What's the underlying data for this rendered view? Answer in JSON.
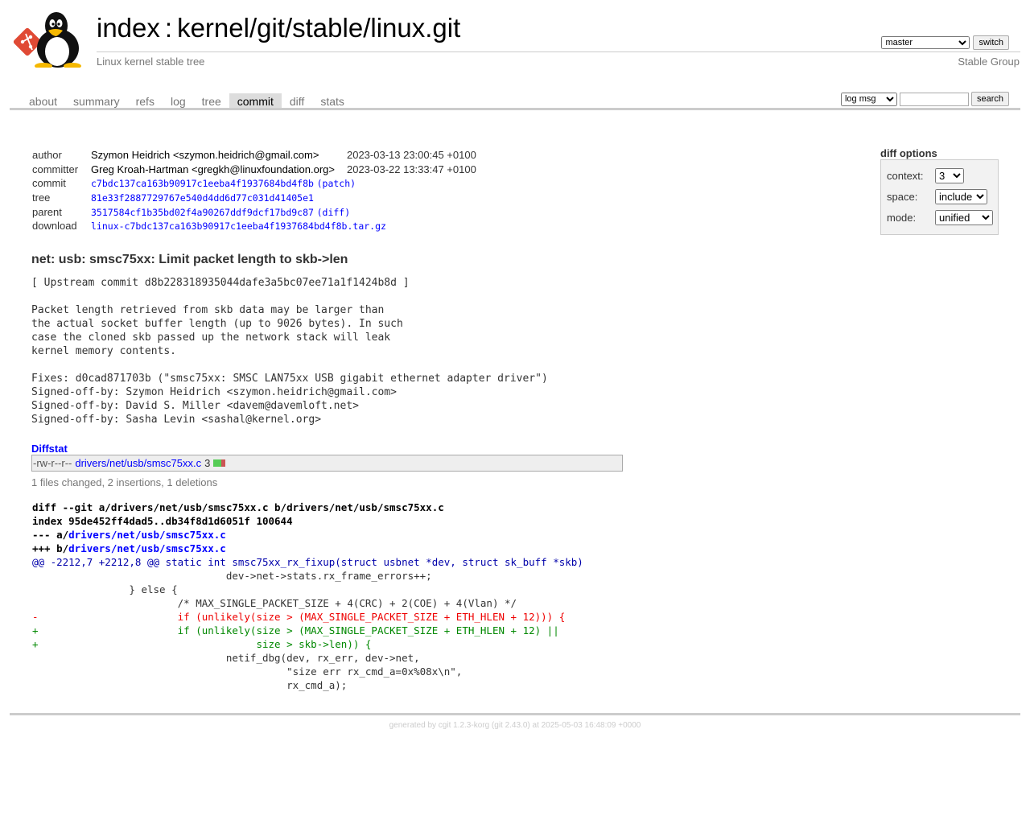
{
  "header": {
    "index_label": "index",
    "repo_path": "kernel/git/stable/linux.git",
    "description": "Linux kernel stable tree",
    "owner": "Stable Group",
    "branch_selected": "master",
    "switch_label": "switch"
  },
  "tabs": [
    {
      "label": "about"
    },
    {
      "label": "summary"
    },
    {
      "label": "refs"
    },
    {
      "label": "log"
    },
    {
      "label": "tree"
    },
    {
      "label": "commit",
      "active": true
    },
    {
      "label": "diff"
    },
    {
      "label": "stats"
    }
  ],
  "search": {
    "scope_selected": "log msg",
    "query": "",
    "button_label": "search"
  },
  "diff_options": {
    "title": "diff options",
    "context_label": "context:",
    "context_value": "3",
    "space_label": "space:",
    "space_value": "include",
    "mode_label": "mode:",
    "mode_value": "unified"
  },
  "commit_info": {
    "author_label": "author",
    "author": "Szymon Heidrich <szymon.heidrich@gmail.com>",
    "author_date": "2023-03-13 23:00:45 +0100",
    "committer_label": "committer",
    "committer": "Greg Kroah-Hartman <gregkh@linuxfoundation.org>",
    "committer_date": "2023-03-22 13:33:47 +0100",
    "commit_label": "commit",
    "commit_hash": "c7bdc137ca163b90917c1eeba4f1937684bd4f8b",
    "patch_label": "patch",
    "tree_label": "tree",
    "tree_hash": "81e33f2887729767e540d4dd6d77c031d41405e1",
    "parent_label": "parent",
    "parent_hash": "3517584cf1b35bd02f4a90267ddf9dcf17bd9c87",
    "diff_label": "diff",
    "download_label": "download",
    "download_file": "linux-c7bdc137ca163b90917c1eeba4f1937684bd4f8b.tar.gz"
  },
  "commit_subject": "net: usb: smsc75xx: Limit packet length to skb->len",
  "commit_message": "[ Upstream commit d8b228318935044dafe3a5bc07ee71a1f1424b8d ]\n\nPacket length retrieved from skb data may be larger than\nthe actual socket buffer length (up to 9026 bytes). In such\ncase the cloned skb passed up the network stack will leak\nkernel memory contents.\n\nFixes: d0cad871703b (\"smsc75xx: SMSC LAN75xx USB gigabit ethernet adapter driver\")\nSigned-off-by: Szymon Heidrich <szymon.heidrich@gmail.com>\nSigned-off-by: David S. Miller <davem@davemloft.net>\nSigned-off-by: Sasha Levin <sashal@kernel.org>",
  "diffstat": {
    "heading": "Diffstat",
    "mode": "-rw-r--r--",
    "file": "drivers/net/usb/smsc75xx.c",
    "count": "3",
    "insertions": 2,
    "deletions": 1,
    "summary": "1 files changed, 2 insertions, 1 deletions"
  },
  "diff": {
    "git_line_prefix": "diff --git a/drivers/net/usb/smsc75xx.c b/drivers/net/usb/smsc75xx.c",
    "index_line": "index 95de452ff4dad5..db34f8d1d6051f 100644",
    "minus_prefix": "--- a/",
    "plus_prefix": "+++ b/",
    "file": "drivers/net/usb/smsc75xx.c",
    "hunk": "@@ -2212,7 +2212,8 @@ static int smsc75xx_rx_fixup(struct usbnet *dev, struct sk_buff *skb)",
    "lines": [
      {
        "type": "ctx",
        "text": "                                dev->net->stats.rx_frame_errors++;"
      },
      {
        "type": "ctx",
        "text": "                } else {"
      },
      {
        "type": "ctx",
        "text": "                        /* MAX_SINGLE_PACKET_SIZE + 4(CRC) + 2(COE) + 4(Vlan) */"
      },
      {
        "type": "del",
        "text": "-                       if (unlikely(size > (MAX_SINGLE_PACKET_SIZE + ETH_HLEN + 12))) {"
      },
      {
        "type": "add",
        "text": "+                       if (unlikely(size > (MAX_SINGLE_PACKET_SIZE + ETH_HLEN + 12) ||"
      },
      {
        "type": "add",
        "text": "+                                    size > skb->len)) {"
      },
      {
        "type": "ctx",
        "text": "                                netif_dbg(dev, rx_err, dev->net,"
      },
      {
        "type": "ctx",
        "text": "                                          \"size err rx_cmd_a=0x%08x\\n\","
      },
      {
        "type": "ctx",
        "text": "                                          rx_cmd_a);"
      }
    ]
  },
  "footer": {
    "text": "generated by cgit 1.2.3-korg (git 2.43.0) at 2025-05-03 16:48:09 +0000"
  },
  "colors": {
    "link": "#0000ff",
    "deletion": "#ee0000",
    "addition": "#008800",
    "hunk": "#0000aa",
    "active_tab_bg": "#dddddd"
  }
}
